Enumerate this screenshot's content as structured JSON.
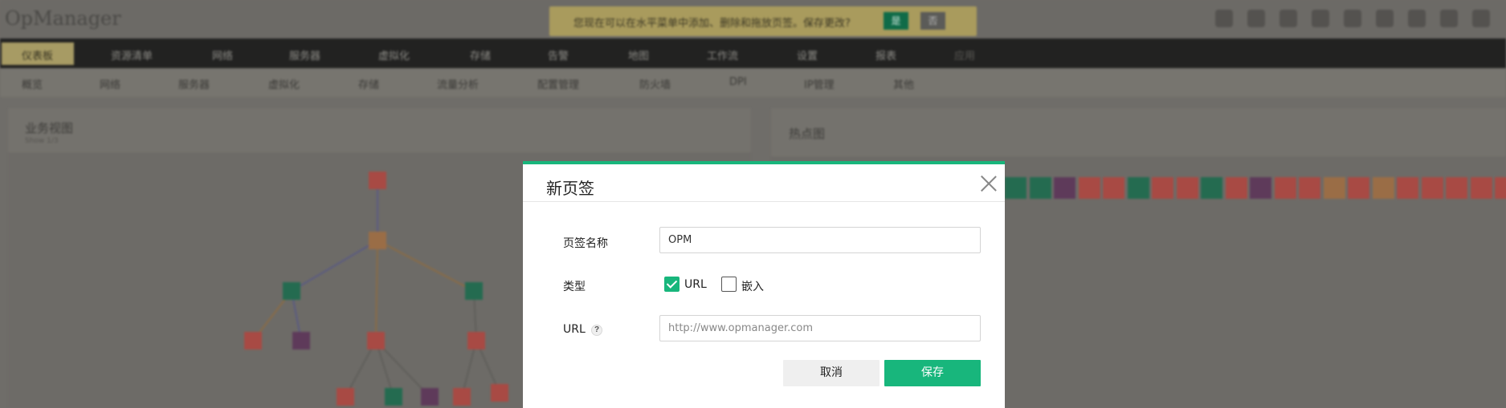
{
  "app": {
    "logo": "OpManager",
    "notice": {
      "text": "您现在可以在水平菜单中添加、删除和拖放页签。保存更改?",
      "yes_label": "是",
      "no_label": "否"
    },
    "main_nav": [
      "仪表板",
      "资源清单",
      "网络",
      "服务器",
      "虚拟化",
      "存储",
      "告警",
      "地图",
      "工作流",
      "设置",
      "报表",
      "应用"
    ],
    "sub_nav": [
      "概览",
      "网络",
      "服务器",
      "虚拟化",
      "存储",
      "流量分析",
      "配置管理",
      "防火墙",
      "DPI",
      "IP管理",
      "其他"
    ],
    "left_panel": {
      "title": "业务视图",
      "subtitle": "Show 1/3"
    },
    "right_panel": {
      "title": "热点图"
    },
    "colors": {
      "node_red": "#a84a44",
      "node_green": "#246b50",
      "node_purple": "#5e3a5a",
      "node_orange": "#9a6d46"
    }
  },
  "modal": {
    "title": "新页签",
    "tab_name_label": "页签名称",
    "tab_name_value": "OPM",
    "type_label": "类型",
    "type_options": [
      {
        "label": "URL",
        "checked": true
      },
      {
        "label": "嵌入",
        "checked": false
      }
    ],
    "url_label": "URL",
    "url_help": "?",
    "url_placeholder": "http://www.opmanager.com",
    "cancel_label": "取消",
    "save_label": "保存",
    "accent_color": "#18b67c"
  }
}
